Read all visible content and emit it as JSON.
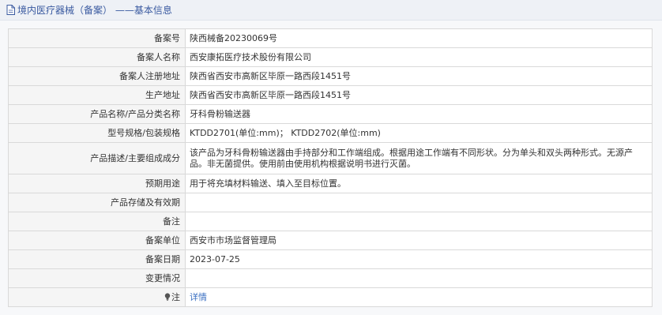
{
  "header": {
    "title": "境内医疗器械（备案） ——基本信息",
    "icon": "document-icon"
  },
  "rows": [
    {
      "label": "备案号",
      "value": "陕西械备20230069号"
    },
    {
      "label": "备案人名称",
      "value": "西安康拓医疗技术股份有限公司"
    },
    {
      "label": "备案人注册地址",
      "value": "陕西省西安市高新区毕原一路西段1451号"
    },
    {
      "label": "生产地址",
      "value": "陕西省西安市高新区毕原一路西段1451号"
    },
    {
      "label": "产品名称/产品分类名称",
      "value": "牙科骨粉输送器"
    },
    {
      "label": "型号规格/包装规格",
      "value": "KTDD2701(单位:mm)； KTDD2702(单位:mm)"
    },
    {
      "label": "产品描述/主要组成成分",
      "value": "该产品为牙科骨粉输送器由手持部分和工作端组成。根据用途工作端有不同形状。分为单头和双头两种形式。无源产品。非无菌提供。使用前由使用机构根据说明书进行灭菌。"
    },
    {
      "label": "预期用途",
      "value": "用于将充填材料输送、填入至目标位置。"
    },
    {
      "label": "产品存储及有效期",
      "value": ""
    },
    {
      "label": "备注",
      "value": ""
    },
    {
      "label": "备案单位",
      "value": "西安市市场监督管理局"
    },
    {
      "label": "备案日期",
      "value": "2023-07-25"
    },
    {
      "label": "变更情况",
      "value": ""
    },
    {
      "label": "注",
      "value": "详情"
    }
  ]
}
